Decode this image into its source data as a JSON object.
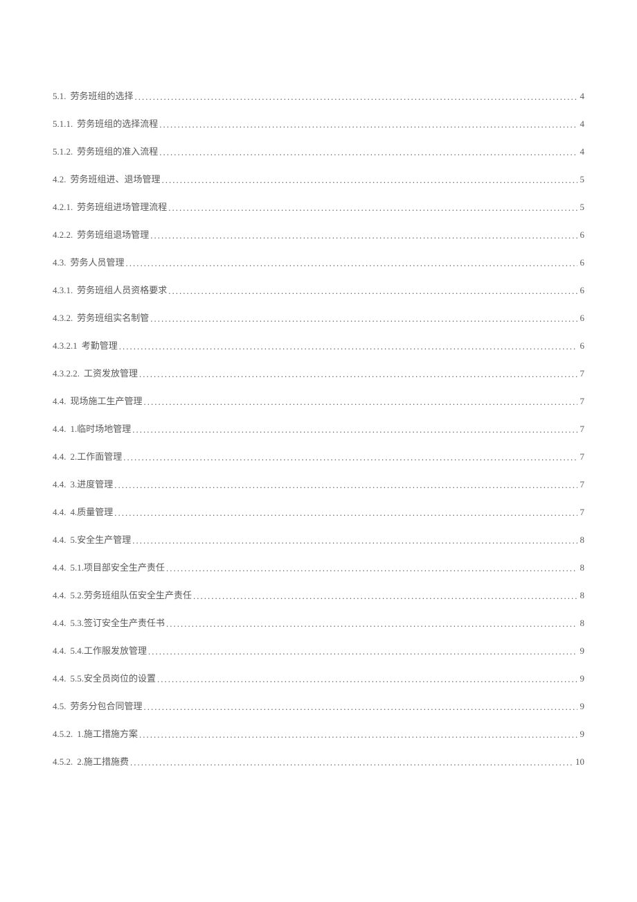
{
  "toc": [
    {
      "num": "5.1.",
      "title": " 劳务班组的选择",
      "page": "4"
    },
    {
      "num": "5.1.1.",
      "title": " 劳务班组的选择流程",
      "page": "4"
    },
    {
      "num": "5.1.2.",
      "title": " 劳务班组的准入流程",
      "page": "4"
    },
    {
      "num": "4.2.",
      "title": "劳务班组进、退场管理",
      "page": "5"
    },
    {
      "num": "4.2.1.",
      "title": "劳务班组进场管理流程",
      "page": "5"
    },
    {
      "num": "4.2.2.",
      "title": "劳务班组退场管理",
      "page": "6"
    },
    {
      "num": "4.3.",
      "title": "劳务人员管理",
      "page": "6"
    },
    {
      "num": "4.3.1.",
      "title": "劳务班组人员资格要求",
      "page": "6"
    },
    {
      "num": "4.3.2.",
      "title": "劳务班组实名制管",
      "page": "6"
    },
    {
      "num": "4.3.2.1",
      "title": "考勤管理",
      "page": "6"
    },
    {
      "num": "4.3.2.2.",
      "title": "工资发放管理",
      "page": "7"
    },
    {
      "num": "4.4.",
      "title": "现场施工生产管理",
      "page": "7"
    },
    {
      "num": "4.4.",
      "title": " 1.临时场地管理",
      "page": "7"
    },
    {
      "num": "4.4.",
      "title": " 2.工作面管理",
      "page": "7"
    },
    {
      "num": "4.4.",
      "title": " 3.进度管理",
      "page": "7"
    },
    {
      "num": "4.4.",
      "title": " 4.质量管理",
      "page": "7"
    },
    {
      "num": "4.4.",
      "title": " 5.安全生产管理",
      "page": "8"
    },
    {
      "num": "4.4.",
      "title": " 5.1.项目部安全生产责任",
      "page": "8"
    },
    {
      "num": "4.4.",
      "title": " 5.2.劳务班组队伍安全生产责任",
      "page": "8"
    },
    {
      "num": "4.4.",
      "title": " 5.3.签订安全生产责任书",
      "page": "8"
    },
    {
      "num": "4.4.",
      "title": " 5.4.工作服发放管理",
      "page": "9"
    },
    {
      "num": "4.4.",
      "title": " 5.5.安全员岗位的设置",
      "page": "9"
    },
    {
      "num": "4.5.",
      "title": "劳务分包合同管理",
      "page": "9"
    },
    {
      "num": "4.5.2.",
      "title": " 1.施工措施方案",
      "page": "9"
    },
    {
      "num": "4.5.2.",
      "title": " 2.施工措施费",
      "page": "10"
    }
  ]
}
